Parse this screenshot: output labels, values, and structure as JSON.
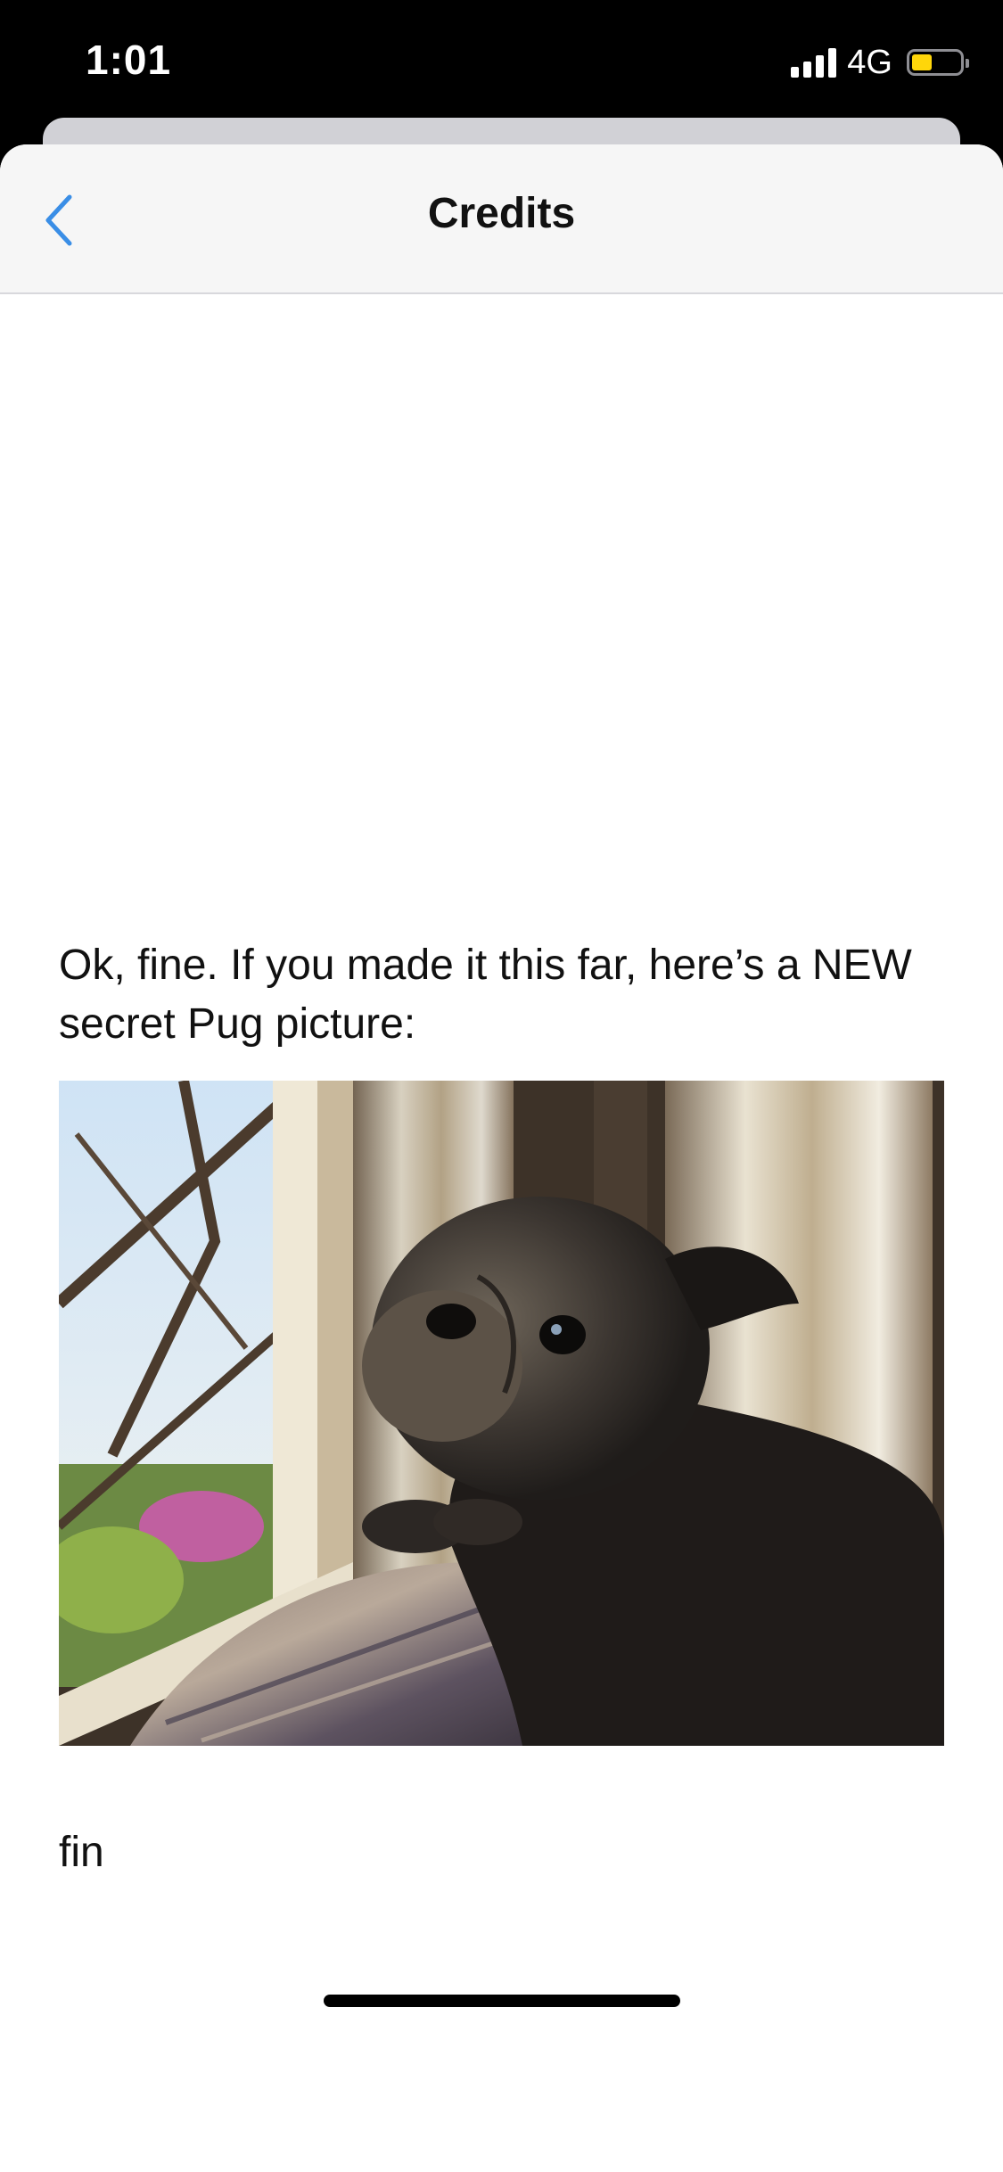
{
  "status_bar": {
    "time": "1:01",
    "network": "4G",
    "battery_color": "#ffd60a"
  },
  "nav": {
    "title": "Credits",
    "back_icon": "chevron-left-icon",
    "accent_color": "#3a8ee6"
  },
  "content": {
    "message": "Ok, fine. If you made it this far, here’s a NEW secret Pug picture:",
    "image_subject": "pug-photo",
    "ending": "fin"
  }
}
